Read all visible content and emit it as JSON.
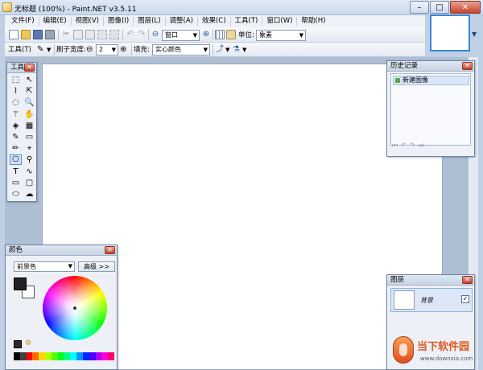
{
  "window": {
    "title": "无标题 (100%) - Paint.NET v3.5.11",
    "minimize": "–",
    "maximize": "□",
    "close": "✕"
  },
  "menus": [
    "文件(F)",
    "编辑(E)",
    "视图(V)",
    "图像(I)",
    "图层(L)",
    "调整(A)",
    "效果(C)",
    "工具(T)",
    "窗口(W)",
    "帮助(H)"
  ],
  "toolbar": {
    "zoom_value": "窗口",
    "units_label": "单位:",
    "units_value": "象素"
  },
  "toolbar2": {
    "tool_label": "工具(T)",
    "brush_width_label": "刷子宽度:",
    "brush_width_value": "2",
    "minus": "⊖",
    "plus": "⊕",
    "fill_label": "填充:",
    "fill_value": "实心颜色"
  },
  "tools_panel": {
    "title": "工具",
    "selected_index": 14,
    "tools": [
      {
        "name": "rectangle-select-icon",
        "glyph": "⬚"
      },
      {
        "name": "move-selection-icon",
        "glyph": "↖"
      },
      {
        "name": "lasso-select-icon",
        "glyph": "⌇"
      },
      {
        "name": "move-selection-outline-icon",
        "glyph": "⇱"
      },
      {
        "name": "ellipse-select-icon",
        "glyph": "◌"
      },
      {
        "name": "zoom-icon",
        "glyph": "🔍"
      },
      {
        "name": "magic-wand-icon",
        "glyph": "⚚"
      },
      {
        "name": "pan-icon",
        "glyph": "✋"
      },
      {
        "name": "paint-bucket-icon",
        "glyph": "◈"
      },
      {
        "name": "gradient-icon",
        "glyph": "▦"
      },
      {
        "name": "paintbrush-icon",
        "glyph": "✎"
      },
      {
        "name": "eraser-icon",
        "glyph": "▭"
      },
      {
        "name": "pencil-icon",
        "glyph": "✏"
      },
      {
        "name": "color-picker-icon",
        "glyph": "⌖"
      },
      {
        "name": "clone-stamp-icon",
        "glyph": "⎔"
      },
      {
        "name": "recolor-icon",
        "glyph": "⚲"
      },
      {
        "name": "text-icon",
        "glyph": "T"
      },
      {
        "name": "line-curve-icon",
        "glyph": "∿"
      },
      {
        "name": "rectangle-icon",
        "glyph": "▭"
      },
      {
        "name": "rounded-rectangle-icon",
        "glyph": "▢"
      },
      {
        "name": "ellipse-icon",
        "glyph": "⬭"
      },
      {
        "name": "freeform-shape-icon",
        "glyph": "☁"
      }
    ]
  },
  "history_panel": {
    "title": "历史记录",
    "items": [
      "新建图像"
    ]
  },
  "colors_panel": {
    "title": "颜色",
    "mode_value": "前景色",
    "more_button": "高级 >>",
    "primary_color": "#222222",
    "secondary_color": "#ffffff",
    "palette": [
      "#000000",
      "#404040",
      "#ff0000",
      "#ff6a00",
      "#ffd800",
      "#b6ff00",
      "#4cff00",
      "#00ff21",
      "#00ff90",
      "#00ffff",
      "#0094ff",
      "#0026ff",
      "#4800ff",
      "#b200ff",
      "#ff00dc",
      "#ff006e"
    ]
  },
  "layers_panel": {
    "title": "图层",
    "layers": [
      {
        "name": "背景",
        "visible": "✓"
      }
    ]
  },
  "watermark": {
    "brand": "当下软件园",
    "url": "www.downxia.com"
  }
}
